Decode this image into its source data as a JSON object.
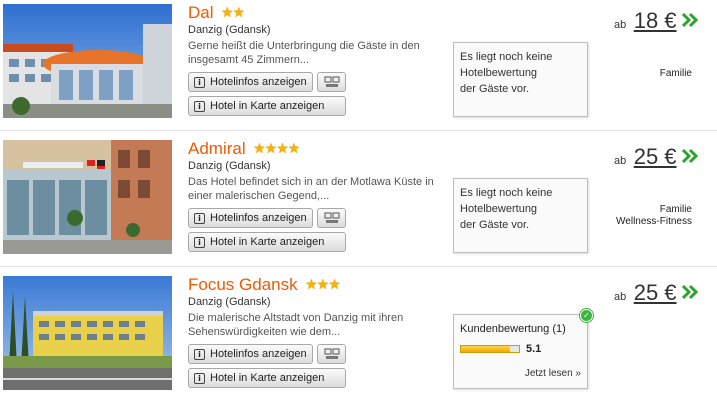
{
  "hotels": [
    {
      "name": "Dal",
      "stars": 2,
      "city": "Danzig (Gdansk)",
      "description": "Gerne heißt die Unterbringung die Gäste in den insgesamt 45 Zimmern...",
      "info_button": "Hotelinfos anzeigen",
      "map_button": "Hotel in Karte anzeigen",
      "review": {
        "type": "none",
        "lines": [
          "Es liegt noch keine",
          "Hotelbewertung",
          "der Gäste vor."
        ]
      },
      "price_prefix": "ab",
      "price": "18 €",
      "tags": [
        "Familie"
      ]
    },
    {
      "name": "Admiral",
      "stars": 4,
      "city": "Danzig (Gdansk)",
      "description": "Das Hotel befindet sich in an der Motlawa Küste in einer malerischen Gegend,...",
      "info_button": "Hotelinfos anzeigen",
      "map_button": "Hotel in Karte anzeigen",
      "review": {
        "type": "none",
        "lines": [
          "Es liegt noch keine",
          "Hotelbewertung",
          "der Gäste vor."
        ]
      },
      "price_prefix": "ab",
      "price": "25 €",
      "tags": [
        "Familie",
        "Wellness-Fitness"
      ]
    },
    {
      "name": "Focus Gdansk",
      "stars": 3,
      "city": "Danzig (Gdansk)",
      "description": "Die malerische Altstadt von Danzig mit ihren Sehenswürdigkeiten wie dem...",
      "info_button": "Hotelinfos anzeigen",
      "map_button": "Hotel in Karte anzeigen",
      "review": {
        "type": "rating",
        "title": "Kundenbewertung (1)",
        "score": "5.1",
        "score_fraction": 0.85,
        "link": "Jetzt lesen »"
      },
      "price_prefix": "ab",
      "price": "25 €",
      "tags": []
    }
  ],
  "colors": {
    "hotel_name": "#f05a00",
    "star": "#f4b400",
    "arrow": "#2aa52a",
    "rating_fill": "#f0a800",
    "check": "#3db33d"
  },
  "icons": {
    "info": "info-icon",
    "compare": "compare-icon",
    "arrow": "double-chevron-right-icon",
    "check": "check-icon"
  }
}
